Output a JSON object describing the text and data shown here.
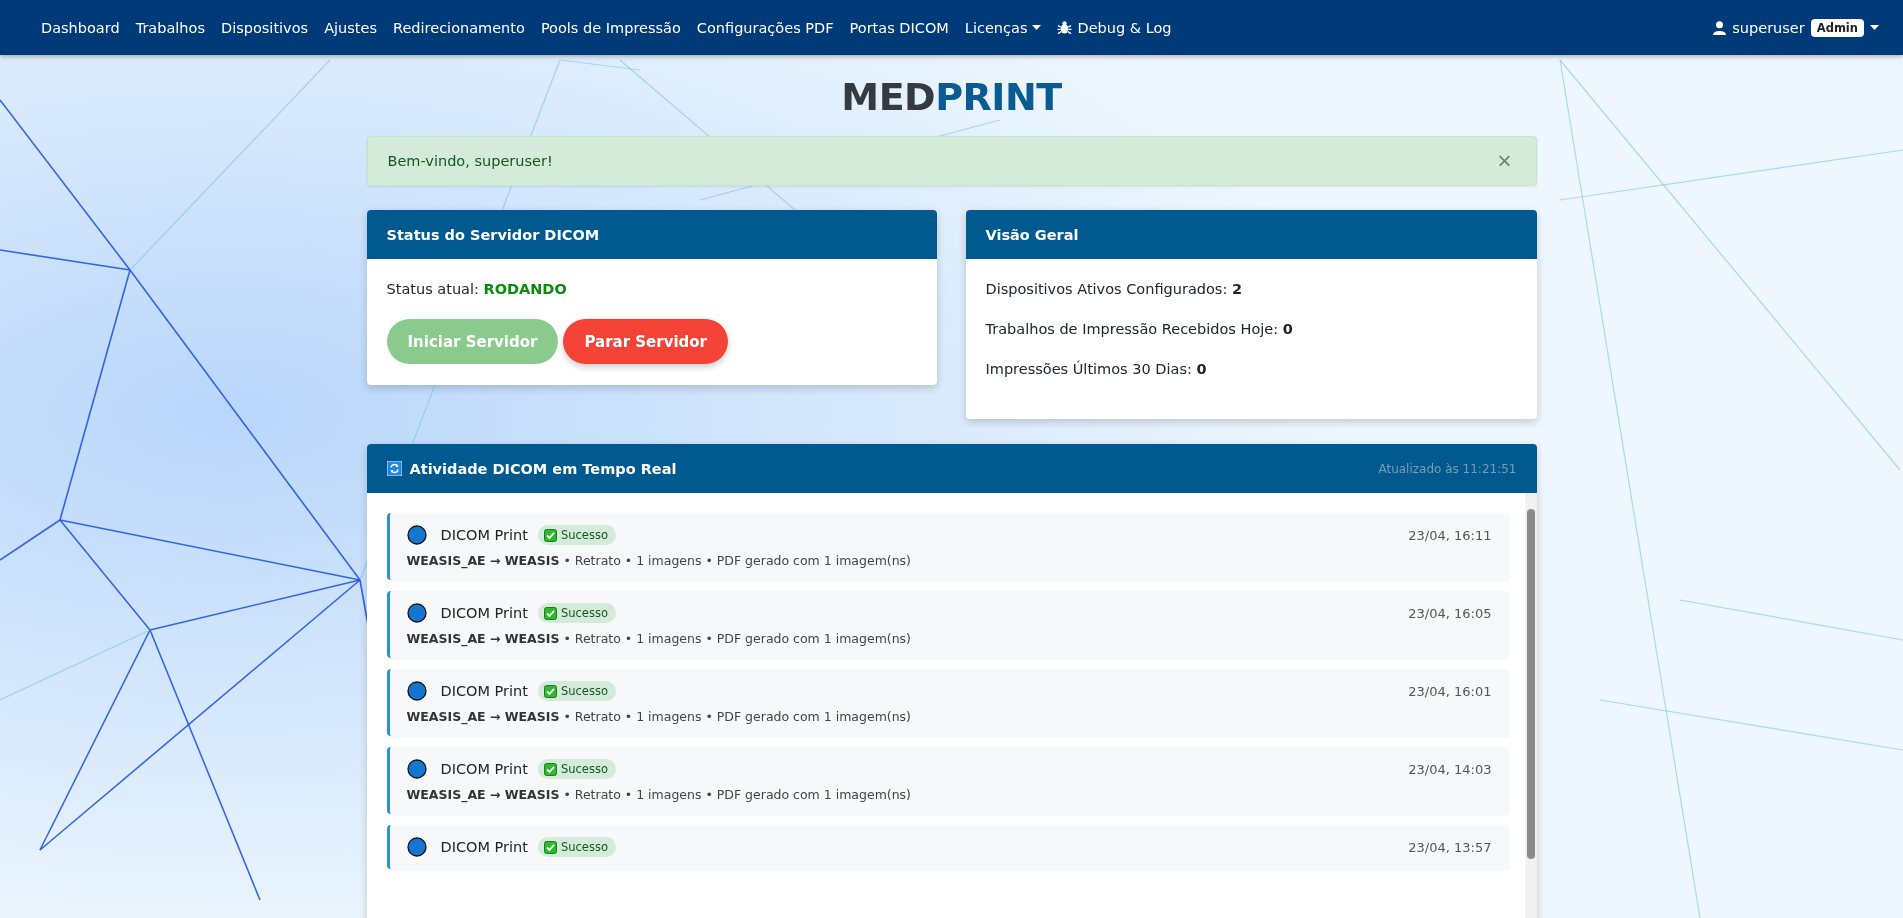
{
  "nav": {
    "items": [
      {
        "label": "Dashboard",
        "kind": "link"
      },
      {
        "label": "Trabalhos",
        "kind": "link"
      },
      {
        "label": "Dispositivos",
        "kind": "link"
      },
      {
        "label": "Ajustes",
        "kind": "link"
      },
      {
        "label": "Redirecionamento",
        "kind": "link"
      },
      {
        "label": "Pools de Impressão",
        "kind": "link"
      },
      {
        "label": "Configurações PDF",
        "kind": "link"
      },
      {
        "label": "Portas DICOM",
        "kind": "link"
      },
      {
        "label": "Licenças",
        "kind": "dropdown"
      },
      {
        "label": "Debug & Log",
        "kind": "bug"
      }
    ],
    "user": {
      "name": "superuser",
      "role": "Admin"
    }
  },
  "brand": {
    "part_1": "MED",
    "part_2": "PRINT"
  },
  "alert": {
    "message": "Bem-vindo, superuser!",
    "close": "×"
  },
  "server_card": {
    "title": "Status do Servidor DICOM",
    "status_label": "Status atual:",
    "status_value": "RODANDO",
    "running": true,
    "buttons": [
      {
        "label": "Iniciar Servidor",
        "kind": "start",
        "disabled": true
      },
      {
        "label": "Parar Servidor",
        "kind": "stop",
        "disabled": false
      }
    ]
  },
  "overview": {
    "title": "Visão Geral",
    "stats": [
      {
        "label": "Dispositivos Ativos Configurados:",
        "value": "2"
      },
      {
        "label": "Trabalhos de Impressão Recebidos Hoje:",
        "value": "0"
      },
      {
        "label": "Impressões Últimos 30 Dias:",
        "value": "0"
      }
    ]
  },
  "activity": {
    "title": "Atividade DICOM em Tempo Real",
    "updated": "Atualizado às 11:21:51",
    "events": [
      {
        "title": "DICOM Print",
        "status": "Sucesso",
        "time": "23/04, 16:11",
        "source": "WEASIS_AE → WEASIS",
        "details": "• Retrato • 1 imagens • PDF gerado com 1 imagem(ns)"
      },
      {
        "title": "DICOM Print",
        "status": "Sucesso",
        "time": "23/04, 16:05",
        "source": "WEASIS_AE → WEASIS",
        "details": "• Retrato • 1 imagens • PDF gerado com 1 imagem(ns)"
      },
      {
        "title": "DICOM Print",
        "status": "Sucesso",
        "time": "23/04, 16:01",
        "source": "WEASIS_AE → WEASIS",
        "details": "• Retrato • 1 imagens • PDF gerado com 1 imagem(ns)"
      },
      {
        "title": "DICOM Print",
        "status": "Sucesso",
        "time": "23/04, 14:03",
        "source": "WEASIS_AE → WEASIS",
        "details": "• Retrato • 1 imagens • PDF gerado com 1 imagem(ns)"
      },
      {
        "title": "DICOM Print",
        "status": "Sucesso",
        "time": "23/04, 13:57"
      }
    ]
  }
}
